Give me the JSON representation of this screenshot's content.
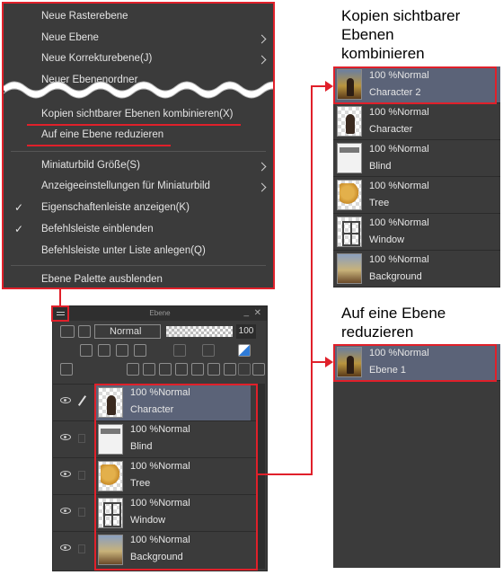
{
  "menu": {
    "items_top": [
      {
        "label": "Neue Rasterebene",
        "submenu": false
      },
      {
        "label": "Neue Ebene",
        "submenu": true
      },
      {
        "label": "Neue Korrekturebene(J)",
        "submenu": true
      },
      {
        "label": "Neuer Ebenenordner",
        "submenu": false
      }
    ],
    "highlight_1": "Kopien sichtbarer Ebenen kombinieren(X)",
    "highlight_2": "Auf eine Ebene reduzieren",
    "items_mid": [
      {
        "label": "Miniaturbild Größe(S)",
        "submenu": true,
        "checked": false
      },
      {
        "label": "Anzeigeeinstellungen für Miniaturbild",
        "submenu": true,
        "checked": false
      },
      {
        "label": "Eigenschaftenleiste anzeigen(K)",
        "submenu": false,
        "checked": true
      },
      {
        "label": "Befehlsleiste einblenden",
        "submenu": false,
        "checked": true
      },
      {
        "label": "Befehlsleiste unter Liste anlegen(Q)",
        "submenu": false,
        "checked": false
      }
    ],
    "item_last": "Ebene Palette ausblenden",
    "check_glyph": "✓"
  },
  "palette": {
    "title": "Ebene",
    "window_controls": {
      "minimize": "_",
      "close": "✕"
    },
    "blend_mode": "Normal",
    "opacity": "100",
    "layers": [
      {
        "mode": "100 %Normal",
        "name": "Character",
        "selected": true,
        "art": "character"
      },
      {
        "mode": "100 %Normal",
        "name": "Blind",
        "selected": false,
        "art": "blind"
      },
      {
        "mode": "100 %Normal",
        "name": "Tree",
        "selected": false,
        "art": "tree"
      },
      {
        "mode": "100 %Normal",
        "name": "Window",
        "selected": false,
        "art": "window"
      },
      {
        "mode": "100 %Normal",
        "name": "Background",
        "selected": false,
        "art": "background"
      }
    ]
  },
  "result_combine": {
    "heading_lines": [
      "Kopien sichtbarer",
      "Ebenen",
      "kombinieren"
    ],
    "layers": [
      {
        "mode": "100 %Normal",
        "name": "Character 2",
        "selected": true,
        "art": "merged"
      },
      {
        "mode": "100 %Normal",
        "name": "Character",
        "selected": false,
        "art": "character"
      },
      {
        "mode": "100 %Normal",
        "name": "Blind",
        "selected": false,
        "art": "blind"
      },
      {
        "mode": "100 %Normal",
        "name": "Tree",
        "selected": false,
        "art": "tree"
      },
      {
        "mode": "100 %Normal",
        "name": "Window",
        "selected": false,
        "art": "window"
      },
      {
        "mode": "100 %Normal",
        "name": "Background",
        "selected": false,
        "art": "background"
      }
    ]
  },
  "result_flatten": {
    "heading_lines": [
      "Auf eine Ebene",
      "reduzieren"
    ],
    "layers": [
      {
        "mode": "100 %Normal",
        "name": "Ebene 1",
        "selected": true,
        "art": "merged"
      }
    ]
  },
  "colors": {
    "accent_red": "#e0202a",
    "selected_row": "#5b6378",
    "panel_bg": "#3b3b3b"
  }
}
